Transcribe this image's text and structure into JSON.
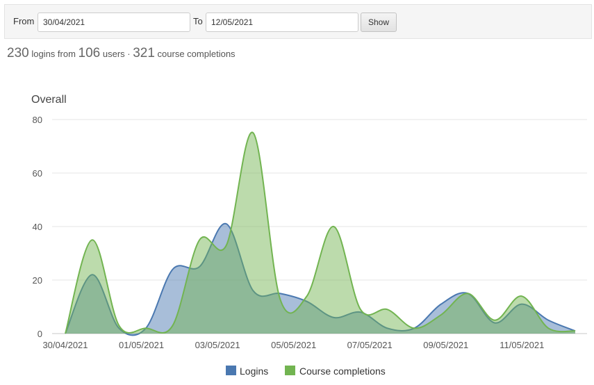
{
  "filter": {
    "from_label": "From",
    "from_value": "30/04/2021",
    "to_label": "To",
    "to_value": "12/05/2021",
    "show_label": "Show"
  },
  "summary": {
    "logins": "230",
    "logins_text": "logins from",
    "users": "106",
    "users_text": "users ·",
    "completions": "321",
    "completions_text": "course completions"
  },
  "chart_data": {
    "type": "area",
    "title": "Overall",
    "xlabel": "",
    "ylabel": "",
    "ylim": [
      0,
      80
    ],
    "yticks": [
      0,
      20,
      40,
      60,
      80
    ],
    "grid": true,
    "legend_position": "bottom",
    "x": [
      "30/04/2021",
      "",
      "01/05/2021",
      "",
      "03/05/2021",
      "",
      "05/05/2021",
      "",
      "07/05/2021",
      "",
      "09/05/2021",
      "",
      "11/05/2021",
      ""
    ],
    "x_label_every": 2,
    "series": [
      {
        "name": "Logins",
        "color": "#4a78b0",
        "values": [
          0,
          22,
          2,
          2,
          24,
          25,
          41,
          16,
          15,
          12,
          6,
          8,
          2,
          2,
          11,
          15,
          4,
          11,
          5,
          1
        ]
      },
      {
        "name": "Course completions",
        "color": "#72b451",
        "values": [
          0,
          35,
          3,
          2,
          3,
          35,
          33,
          75,
          13,
          14,
          40,
          9,
          9,
          2,
          7,
          15,
          5,
          14,
          2,
          1
        ]
      }
    ]
  }
}
